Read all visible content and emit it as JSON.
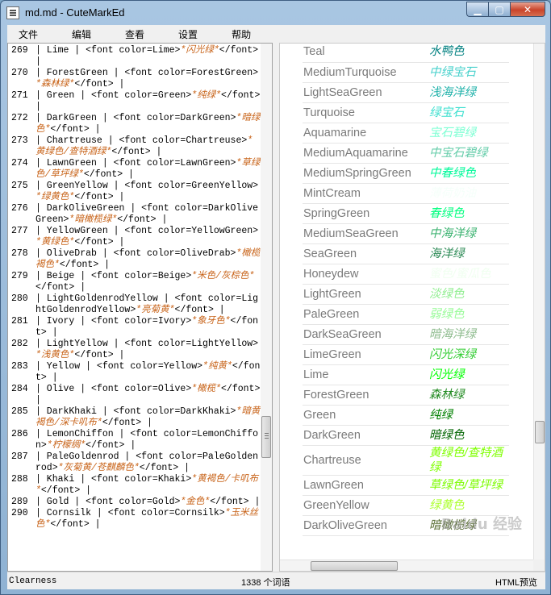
{
  "window": {
    "title": "md.md - CuteMarkEd"
  },
  "menu": [
    "文件",
    "编辑",
    "查看",
    "设置",
    "帮助"
  ],
  "editor_lines": [
    {
      "n": "269",
      "pre": "| Lime | <font color=Lime>",
      "em": "*闪光绿*",
      "post": "</font> |"
    },
    {
      "n": "270",
      "pre": "| ForestGreen | <font color=ForestGreen>",
      "em": "*森林绿*",
      "post": "</font> |"
    },
    {
      "n": "271",
      "pre": "| Green | <font color=Green>",
      "em": "*纯绿*",
      "post": "</font> |"
    },
    {
      "n": "272",
      "pre": "| DarkGreen | <font color=DarkGreen>",
      "em": "*暗绿色*",
      "post": "</font> |"
    },
    {
      "n": "273",
      "pre": "| Chartreuse | <font color=Chartreuse>",
      "em": "*黄绿色/查特酒绿*",
      "post": "</font> |"
    },
    {
      "n": "274",
      "pre": "| LawnGreen | <font color=LawnGreen>",
      "em": "*草绿色/草坪绿*",
      "post": "</font> |"
    },
    {
      "n": "275",
      "pre": "| GreenYellow | <font color=GreenYellow>",
      "em": "*绿黄色*",
      "post": "</font> |"
    },
    {
      "n": "276",
      "pre": "| DarkOliveGreen | <font color=DarkOliveGreen>",
      "em": "*暗橄榄绿*",
      "post": "</font> |"
    },
    {
      "n": "277",
      "pre": "| YellowGreen | <font color=YellowGreen>",
      "em": "*黄绿色*",
      "post": "</font> |"
    },
    {
      "n": "278",
      "pre": "| OliveDrab | <font color=OliveDrab>",
      "em": "*橄榄褐色*",
      "post": "</font> |"
    },
    {
      "n": "279",
      "pre": "| Beige | <font color=Beige>",
      "em": "*米色/灰棕色*",
      "post": "</font> |"
    },
    {
      "n": "280",
      "pre": "| LightGoldenrodYellow | <font color=LightGoldenrodYellow>",
      "em": "*亮菊黄*",
      "post": "</font> |"
    },
    {
      "n": "281",
      "pre": "| Ivory | <font color=Ivory>",
      "em": "*象牙色*",
      "post": "</font> |"
    },
    {
      "n": "282",
      "pre": "| LightYellow | <font color=LightYellow>",
      "em": "*浅黄色*",
      "post": "</font> |"
    },
    {
      "n": "283",
      "pre": "| Yellow | <font color=Yellow>",
      "em": "*纯黄*",
      "post": "</font> |"
    },
    {
      "n": "284",
      "pre": "| Olive | <font color=Olive>",
      "em": "*橄榄*",
      "post": "</font> |"
    },
    {
      "n": "285",
      "pre": "| DarkKhaki | <font color=DarkKhaki>",
      "em": "*暗黄褐色/深卡叽布*",
      "post": "</font> |"
    },
    {
      "n": "286",
      "pre": "| LemonChiffon | <font color=LemonChiffon>",
      "em": "*柠檬绸*",
      "post": "</font> |"
    },
    {
      "n": "287",
      "pre": "| PaleGoldenrod | <font color=PaleGoldenrod>",
      "em": "*灰菊黄/苍麒麟色*",
      "post": "</font> |"
    },
    {
      "n": "288",
      "pre": "| Khaki | <font color=Khaki>",
      "em": "*黄褐色/卡叽布*",
      "post": "</font> |"
    },
    {
      "n": "289",
      "pre": "| Gold | <font color=Gold>",
      "em": "*金色*",
      "post": "</font> |"
    },
    {
      "n": "290",
      "pre": "| Cornsilk | <font color=Cornsilk>",
      "em": "*玉米丝色*",
      "post": "</font> |"
    }
  ],
  "preview_rows": [
    {
      "name": "Teal",
      "label": "水鸭色",
      "color": "#008080"
    },
    {
      "name": "MediumTurquoise",
      "label": "中绿宝石",
      "color": "#48D1CC"
    },
    {
      "name": "LightSeaGreen",
      "label": "浅海洋绿",
      "color": "#20B2AA"
    },
    {
      "name": "Turquoise",
      "label": "绿宝石",
      "color": "#40E0D0"
    },
    {
      "name": "Aquamarine",
      "label": "宝石碧绿",
      "color": "#7FFFD4"
    },
    {
      "name": "MediumAquamarine",
      "label": "中宝石碧绿",
      "color": "#66CDAA"
    },
    {
      "name": "MediumSpringGreen",
      "label": "中春绿色",
      "color": "#00FA9A"
    },
    {
      "name": "MintCream",
      "label": "薄荷奶油",
      "color": "#F5FFFA"
    },
    {
      "name": "SpringGreen",
      "label": "春绿色",
      "color": "#00FF7F"
    },
    {
      "name": "MediumSeaGreen",
      "label": "中海洋绿",
      "color": "#3CB371"
    },
    {
      "name": "SeaGreen",
      "label": "海洋绿",
      "color": "#2E8B57"
    },
    {
      "name": "Honeydew",
      "label": "蜜色/蜜瓜色",
      "color": "#F0FFF0"
    },
    {
      "name": "LightGreen",
      "label": "淡绿色",
      "color": "#90EE90"
    },
    {
      "name": "PaleGreen",
      "label": "弱绿色",
      "color": "#98FB98"
    },
    {
      "name": "DarkSeaGreen",
      "label": "暗海洋绿",
      "color": "#8FBC8F"
    },
    {
      "name": "LimeGreen",
      "label": "闪光深绿",
      "color": "#32CD32"
    },
    {
      "name": "Lime",
      "label": "闪光绿",
      "color": "#00FF00"
    },
    {
      "name": "ForestGreen",
      "label": "森林绿",
      "color": "#228B22"
    },
    {
      "name": "Green",
      "label": "纯绿",
      "color": "#008000"
    },
    {
      "name": "DarkGreen",
      "label": "暗绿色",
      "color": "#006400"
    },
    {
      "name": "Chartreuse",
      "label": "黄绿色/查特酒绿",
      "color": "#7FFF00"
    },
    {
      "name": "LawnGreen",
      "label": "草绿色/草坪绿",
      "color": "#7CFC00"
    },
    {
      "name": "GreenYellow",
      "label": "绿黄色",
      "color": "#ADFF2F"
    },
    {
      "name": "DarkOliveGreen",
      "label": "暗橄榄绿",
      "color": "#556B2F"
    }
  ],
  "status": {
    "left": "Clearness",
    "mid": "1338 个词语",
    "right": "HTML预览"
  },
  "watermark": "Baidu 经验"
}
